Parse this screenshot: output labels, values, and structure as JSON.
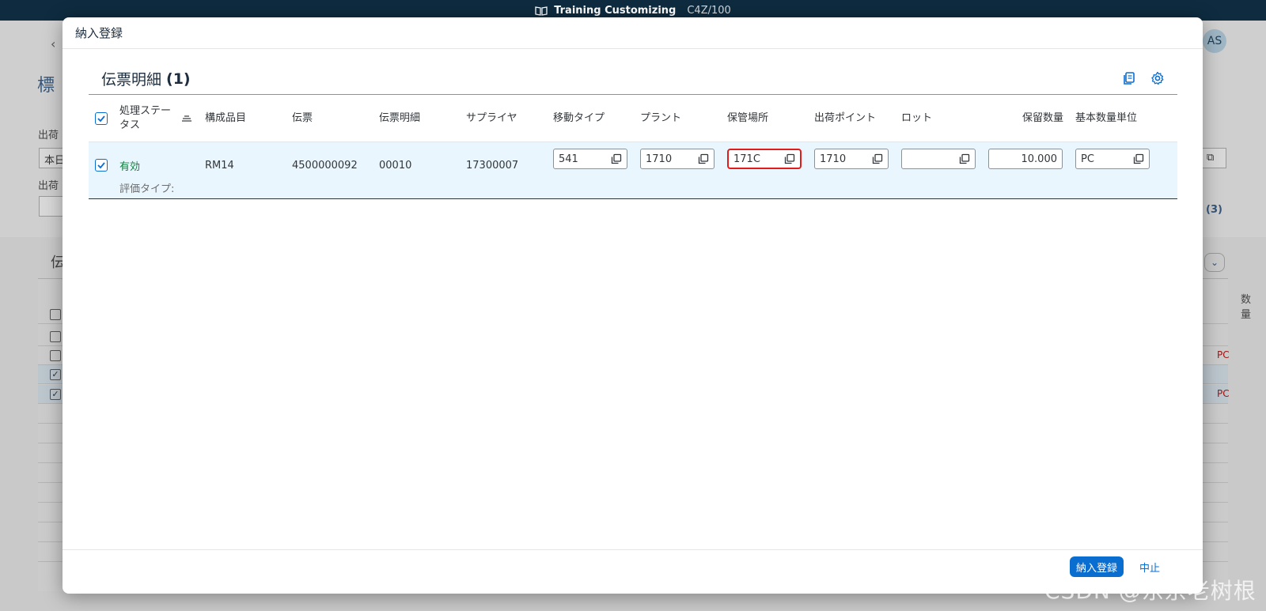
{
  "shell": {
    "title": "Training Customizing",
    "system": "C4Z/100"
  },
  "background": {
    "avatar": "AS",
    "heading": "標",
    "label1": "出荷",
    "input1": "本日",
    "label2": "出荷",
    "count": "(3)",
    "table_title": "伝",
    "col_right": "数量",
    "pc": "PC"
  },
  "dialog": {
    "title": "納入登録",
    "panel": {
      "title": "伝票明細",
      "count": "(1)",
      "columns": {
        "status": "処理ステータス",
        "component": "構成品目",
        "document": "伝票",
        "item": "伝票明細",
        "supplier": "サプライヤ",
        "movement_type": "移動タイプ",
        "plant": "プラント",
        "storage_location": "保管場所",
        "shipping_point": "出荷ポイント",
        "batch": "ロット",
        "reserved_qty": "保留数量",
        "base_unit": "基本数量単位"
      },
      "row": {
        "status": "有効",
        "component": "RM14",
        "document": "4500000092",
        "item": "00010",
        "supplier": "17300007",
        "movement_type": "541",
        "plant": "1710",
        "storage_location": "171C",
        "shipping_point": "1710",
        "batch": "",
        "reserved_qty": "10.000",
        "base_unit": "PC",
        "valuation_label": "評価タイプ:"
      }
    },
    "footer": {
      "primary": "納入登録",
      "cancel": "中止"
    }
  },
  "colors": {
    "accent": "#0a6ed1",
    "shell": "#0e2b3f",
    "status_ok": "#107e3e",
    "highlight": "#e31b1b"
  },
  "watermark": "CSDN @东京老树根"
}
